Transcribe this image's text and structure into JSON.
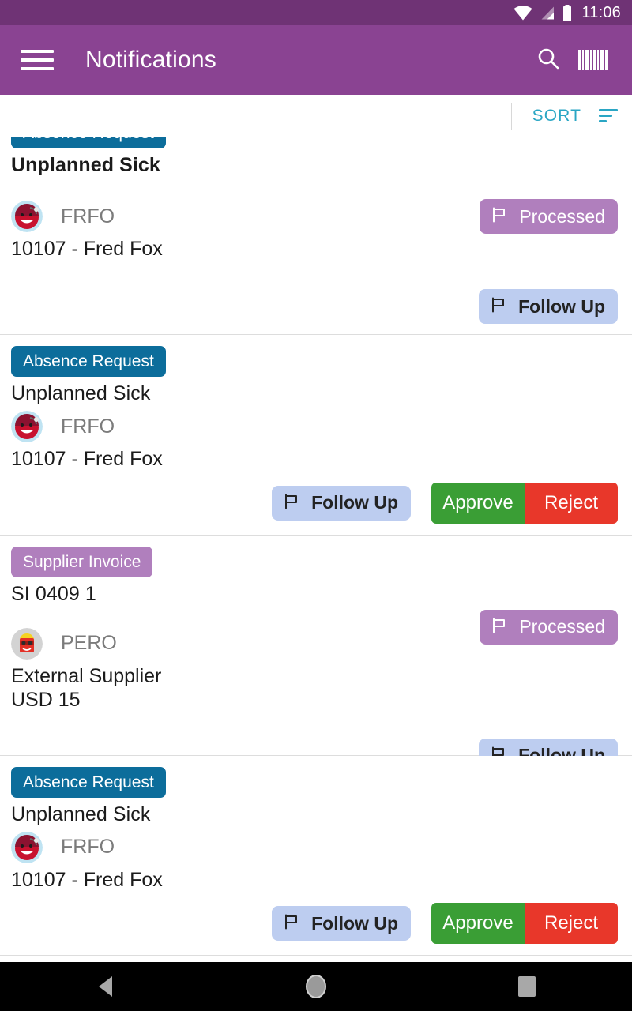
{
  "statusbar": {
    "time": "11:06",
    "icons": [
      "wifi-icon",
      "signal-icon",
      "battery-icon"
    ]
  },
  "appbar": {
    "title": "Notifications",
    "menu_icon": "hamburger-menu-icon",
    "search_icon": "search-icon",
    "barcode_icon": "barcode-scan-icon",
    "background_color": "#8a4392"
  },
  "sortbar": {
    "label": "SORT",
    "icon": "sort-icon",
    "color": "#2aa6c4"
  },
  "labels": {
    "processed": "Processed",
    "follow_up": "Follow Up",
    "approve": "Approve",
    "reject": "Reject",
    "flag_icon": "flag-icon"
  },
  "colors": {
    "badge_absence": "#0c6d9b",
    "badge_invoice": "#b07fbd",
    "processed": "#b07fbd",
    "follow_up": "#bdcdf0",
    "approve": "#3a9e35",
    "reject": "#e8372a"
  },
  "notifications": [
    {
      "badge": "Absence Request",
      "badge_type": "absence",
      "title": "Unplanned Sick",
      "title_bold": true,
      "avatar": "avatar-frfo-red-face",
      "code": "FRFO",
      "subtitle": "10107 - Fred Fox",
      "status": "Processed",
      "secondary": "Follow Up",
      "clipped": true
    },
    {
      "badge": "Absence Request",
      "badge_type": "absence",
      "title": "Unplanned Sick",
      "title_bold": false,
      "avatar": "avatar-frfo-red-face",
      "code": "FRFO",
      "subtitle": "10107 - Fred Fox",
      "actions": [
        "Follow Up",
        "Approve",
        "Reject"
      ],
      "clipped": false
    },
    {
      "badge": "Supplier Invoice",
      "badge_type": "invoice",
      "title": "SI 0409 1",
      "title_bold": false,
      "avatar": "avatar-pero-sunglasses",
      "code": "PERO",
      "subtitle": "External Supplier\nUSD 15",
      "subtitle_line1": "External Supplier",
      "subtitle_line2": "USD 15",
      "status": "Processed",
      "secondary": "Follow Up",
      "clipped": false
    },
    {
      "badge": "Absence Request",
      "badge_type": "absence",
      "title": "Unplanned Sick",
      "title_bold": false,
      "avatar": "avatar-frfo-red-face",
      "code": "FRFO",
      "subtitle": "10107 - Fred Fox",
      "actions": [
        "Follow Up",
        "Approve",
        "Reject"
      ],
      "clipped": false
    }
  ],
  "navbar": {
    "back": "back-icon",
    "home": "home-icon",
    "recents": "recents-icon"
  }
}
